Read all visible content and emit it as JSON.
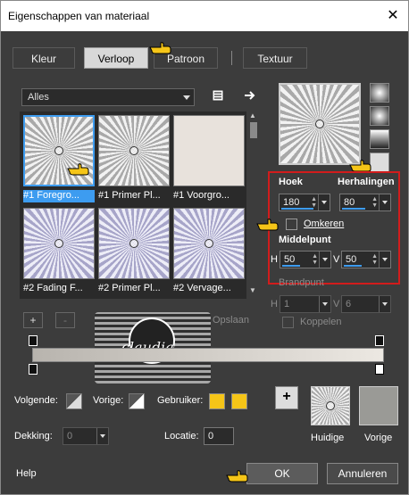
{
  "window": {
    "title": "Eigenschappen van materiaal",
    "close_glyph": "✕"
  },
  "tabs": [
    {
      "label": "Kleur"
    },
    {
      "label": "Verloop"
    },
    {
      "label": "Patroon"
    },
    {
      "label": "Textuur"
    }
  ],
  "gallery": {
    "filter_value": "Alles",
    "items": [
      {
        "caption": "#1 Foregro..."
      },
      {
        "caption": "#1 Primer Pl..."
      },
      {
        "caption": "#1 Voorgro..."
      },
      {
        "caption": "#2 Fading F..."
      },
      {
        "caption": "#2 Primer Pl..."
      },
      {
        "caption": "#2 Vervage..."
      }
    ],
    "add_label": "+",
    "remove_label": "-",
    "save_label": "Opslaan"
  },
  "gradient": {
    "angle_label": "Hoek",
    "angle_value": "180",
    "repeats_label": "Herhalingen",
    "repeats_value": "80",
    "invert_label": "Omkeren",
    "center_label": "Middelpunt",
    "center_h_label": "H",
    "center_h_value": "50",
    "center_v_label": "V",
    "center_v_value": "50",
    "focus_label": "Brandpunt",
    "focus_h_label": "H",
    "focus_h_value": "1",
    "focus_v_label": "V",
    "focus_v_value": "6",
    "link_label": "Koppelen"
  },
  "stops": {
    "next_label": "Volgende:",
    "prev_label": "Vorige:",
    "user_label": "Gebruiker:",
    "user_color": "#f5c518",
    "opacity_label": "Dekking:",
    "opacity_value": "0",
    "location_label": "Locatie:",
    "location_value": "0"
  },
  "current_label": "Huidige",
  "previous_label": "Vorige",
  "plus_label": "+",
  "help_label": "Help",
  "ok_label": "OK",
  "cancel_label": "Annuleren",
  "watermark_text": "claudia",
  "colors": {
    "accent": "#3d9cf0",
    "highlight_box": "#d21c1c",
    "user_color": "#f5c518"
  }
}
